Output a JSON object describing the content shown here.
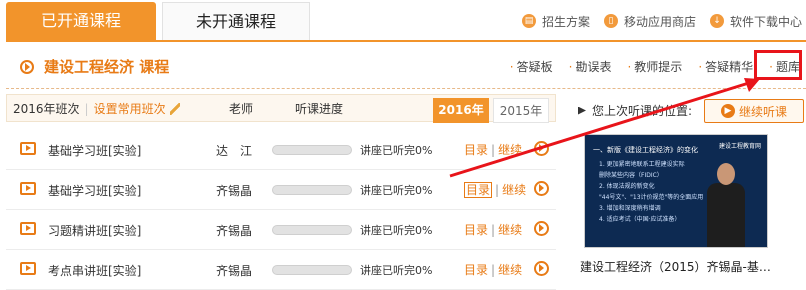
{
  "tabs": {
    "active": "已开通课程",
    "inactive": "未开通课程"
  },
  "top_links": [
    {
      "icon": "document-icon",
      "label": "招生方案"
    },
    {
      "icon": "mobile-icon",
      "label": "移动应用商店"
    },
    {
      "icon": "download-icon",
      "label": "软件下载中心"
    }
  ],
  "course": {
    "title": "建设工程经济  课程"
  },
  "sub_links": [
    "答疑板",
    "勘误表",
    "教师提示",
    "答疑精华",
    "题库"
  ],
  "table_header": {
    "class_year": "2016年班次",
    "set_common": "设置常用班次",
    "teacher": "老师",
    "progress": "听课进度",
    "year_active": "2016年",
    "year_inactive": "2015年"
  },
  "rows": [
    {
      "name": "基础学习班[实验]",
      "teacher": "达　江",
      "status": "讲座已听完0%",
      "mulu": "目录",
      "jixu": "继续"
    },
    {
      "name": "基础学习班[实验]",
      "teacher": "齐锡晶",
      "status": "讲座已听完0%",
      "mulu": "目录",
      "jixu": "继续"
    },
    {
      "name": "习题精讲班[实验]",
      "teacher": "齐锡晶",
      "status": "讲座已听完0%",
      "mulu": "目录",
      "jixu": "继续"
    },
    {
      "name": "考点串讲班[实验]",
      "teacher": "齐锡晶",
      "status": "讲座已听完0%",
      "mulu": "目录",
      "jixu": "继续"
    }
  ],
  "last_watched": {
    "label": "您上次听课的位置:",
    "button": "继续听课",
    "caption": "建设工程经济（2015）齐锡晶-基…",
    "thumb_title": "一、新版《建设工程经济》的变化",
    "thumb_lines": [
      "1. 更加紧密地联系工程建设实际",
      "删除某些内容（FIDIC）",
      "2. 体现法规的新变化",
      "\"44号文\"、\"13计价规范\"等的全面应用",
      "3. 增加和深度稍有增调",
      "4. 适应考试（中国·应试准备）"
    ],
    "thumb_logo": "建设工程教育网"
  }
}
